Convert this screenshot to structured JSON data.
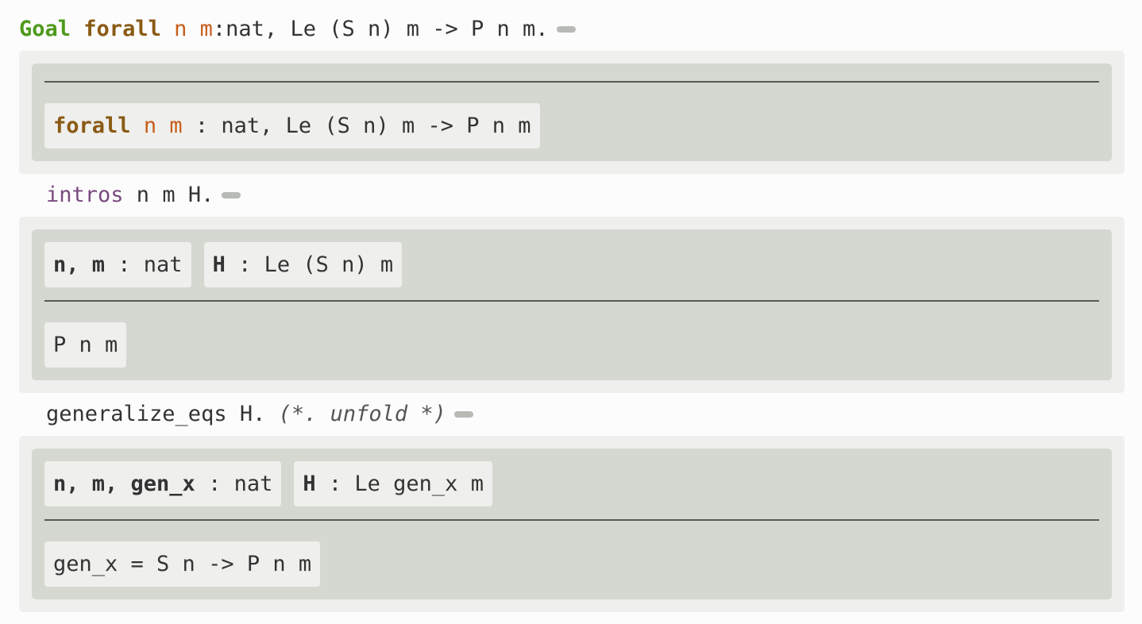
{
  "goal_sentence": {
    "keyword": "Goal",
    "forall": "forall",
    "var_n": "n",
    "var_m": "m",
    "rest": ":nat, Le (S n) m -> P n m."
  },
  "block1": {
    "goal": {
      "forall": "forall",
      "var_n": "n",
      "var_m": "m",
      "rest": " : nat, Le (S n) m -> P n m"
    }
  },
  "step2": {
    "tactic": "intros",
    "args": " n m H."
  },
  "block2": {
    "hyps": [
      {
        "names": "n, m",
        "type": " : nat"
      },
      {
        "names": "H",
        "type": " : Le (S n) m"
      }
    ],
    "goal": "P n m"
  },
  "step3": {
    "tactic": "generalize_eqs H. ",
    "comment": "(*. unfold *)"
  },
  "block3": {
    "hyps": [
      {
        "names": "n, m, gen_x",
        "type": " : nat"
      },
      {
        "names": "H",
        "type": " : Le gen_x m"
      }
    ],
    "goal": "gen_x = S n -> P n m"
  }
}
